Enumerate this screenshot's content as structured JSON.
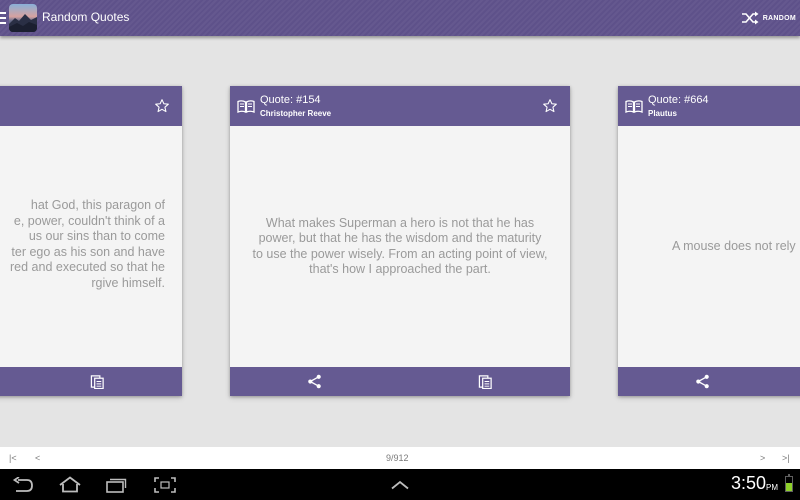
{
  "app": {
    "title": "Random Quotes",
    "random_label": "RANDOM"
  },
  "cards": [
    {
      "id": "left",
      "quote_text": "...that God, this paragon of... power, couldn't think of a... us our sins than to come... ter ego as his son and have... red and executed so that he... rgive himself.",
      "lines": [
        "hat God, this paragon of",
        "e, power, couldn't think of a",
        "us our sins than to come",
        "ter ego as his son and have",
        "red and executed so that he",
        "rgive himself."
      ]
    },
    {
      "id": "center",
      "quote_number": "Quote: #154",
      "author": "Christopher Reeve",
      "quote_text": "What makes Superman a hero is not that he has power, but that he has the wisdom and the maturity to use the power wisely. From an acting point of view, that's how I approached the part."
    },
    {
      "id": "right",
      "quote_number": "Quote: #664",
      "author": "Plautus",
      "quote_text": "A mouse does not rely"
    }
  ],
  "pager": {
    "first": "|<",
    "prev": "<",
    "position": "9/912",
    "next": ">",
    "last": ">|"
  },
  "status": {
    "time": "3:50",
    "ampm": "PM",
    "battery_level": 0.55,
    "battery_color": "#8fd12a"
  },
  "colors": {
    "appbar": "#5e518a",
    "card_header": "#655a92",
    "quote_text": "#9a9a9a"
  },
  "icons": {
    "menu": "menu-icon",
    "shuffle": "shuffle-icon",
    "book": "book-icon",
    "star": "star-outline-icon",
    "share": "share-icon",
    "copy": "copy-icon",
    "back": "back-icon",
    "home": "home-icon",
    "recents": "recents-icon",
    "screenshot": "screenshot-icon",
    "chevron_up": "chevron-up-icon",
    "battery": "battery-icon"
  }
}
